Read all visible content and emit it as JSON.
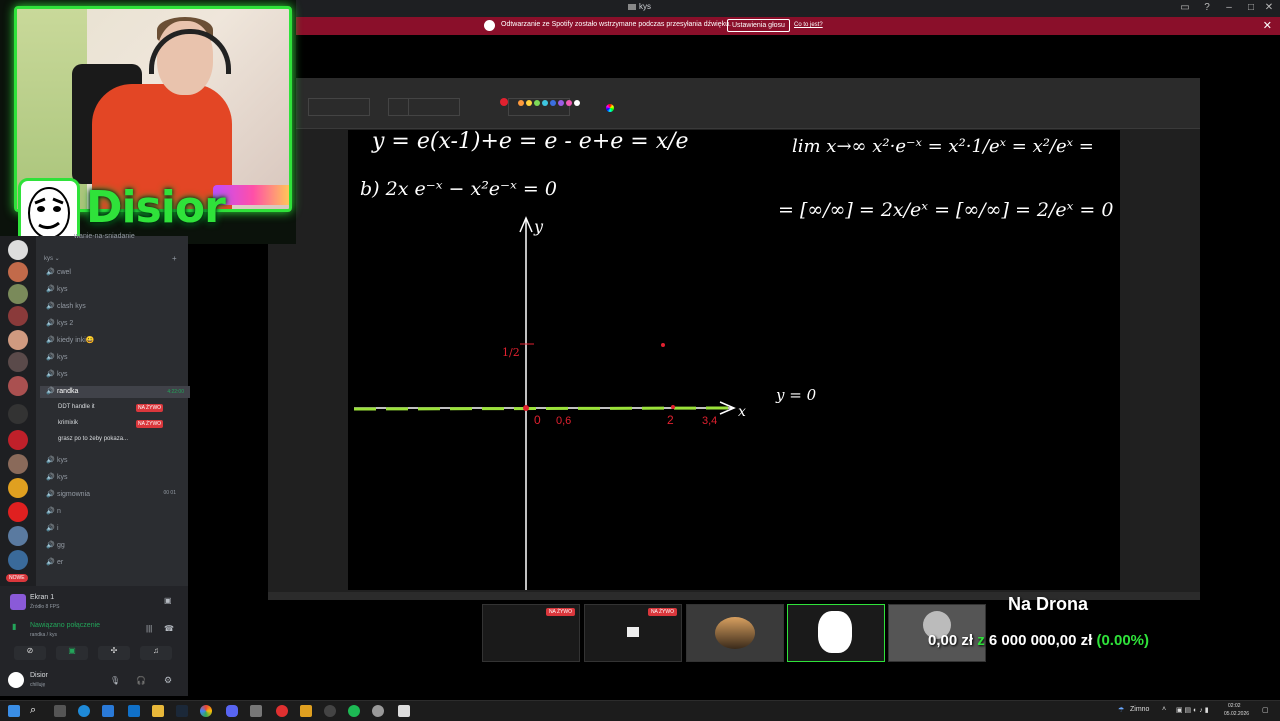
{
  "window": {
    "title": "kys"
  },
  "banner": {
    "message": "Odtwarzanie ze Spotify zostało wstrzymane podczas przesyłania dźwięku.",
    "button": "Ustawienia głosu",
    "link": "Co to jest?"
  },
  "stream": {
    "name": "Disior"
  },
  "discord": {
    "header_partial": "wanie-na-sniadanie",
    "category": "kys",
    "channels": [
      {
        "label": "cwel"
      },
      {
        "label": "kys"
      },
      {
        "label": "clash kys"
      },
      {
        "label": "kys 2"
      },
      {
        "label": "kiedy inki😀"
      },
      {
        "label": "kys"
      },
      {
        "label": "kys"
      }
    ],
    "active_channel": {
      "label": "randka",
      "time": "4:22:00"
    },
    "voice_users": [
      {
        "name": "DDT handle it",
        "badge": "NA ŻYWO"
      },
      {
        "name": "krimixik",
        "badge": "NA ŻYWO"
      },
      {
        "name": "grasz po to żeby pokaza...",
        "badge": ""
      }
    ],
    "channels_after": [
      {
        "label": "kys"
      },
      {
        "label": "kys"
      },
      {
        "label": "sigmownia",
        "counts": "00 01"
      },
      {
        "label": "n"
      },
      {
        "label": "i"
      },
      {
        "label": "gg"
      },
      {
        "label": "er"
      }
    ],
    "new_badge": "NOWE",
    "screen": {
      "title": "Ekran 1",
      "sub": "Źródło 8 FPS"
    },
    "connection": {
      "status": "Nawiązano połączenie",
      "channel": "randka / kys"
    },
    "user": {
      "name": "Disior",
      "status": "chilluję"
    }
  },
  "math": {
    "line1": "y = e(x-1)+e = e - e+e = x/e",
    "part_b": "b)  2x e⁻ˣ − x²e⁻ˣ = 0",
    "limit1": "lim x→∞  x²·e⁻ˣ = x²·1/eˣ = x²/eˣ =",
    "limit2": "= [∞/∞] = 2x/eˣ = [∞/∞] = 2/eˣ = 0",
    "y_axis": "y",
    "x_axis": "x",
    "half": "1/2",
    "asymptote": "y = 0",
    "ticks": [
      "0",
      "0,6",
      "2",
      "3,4"
    ]
  },
  "thumbnails": [
    {
      "badge": "NA ŻYWO"
    },
    {
      "badge": "NA ŻYWO"
    },
    {
      "badge": ""
    },
    {
      "badge": ""
    },
    {
      "badge": ""
    }
  ],
  "goal": {
    "title": "Na Drona",
    "current": "0,00 zł",
    "sep": "z",
    "target": "6 000 000,00 zł",
    "pct": "(0.00%)"
  },
  "taskbar": {
    "weather": "Zimno",
    "time": "02:02",
    "date": "05.02.2026"
  },
  "colors": {
    "accent_green": "#2fe23a",
    "banner_red": "#8a0f2a",
    "live_red": "#da373c",
    "ink_red": "#e0212f",
    "highlight_green": "#9be23a"
  }
}
